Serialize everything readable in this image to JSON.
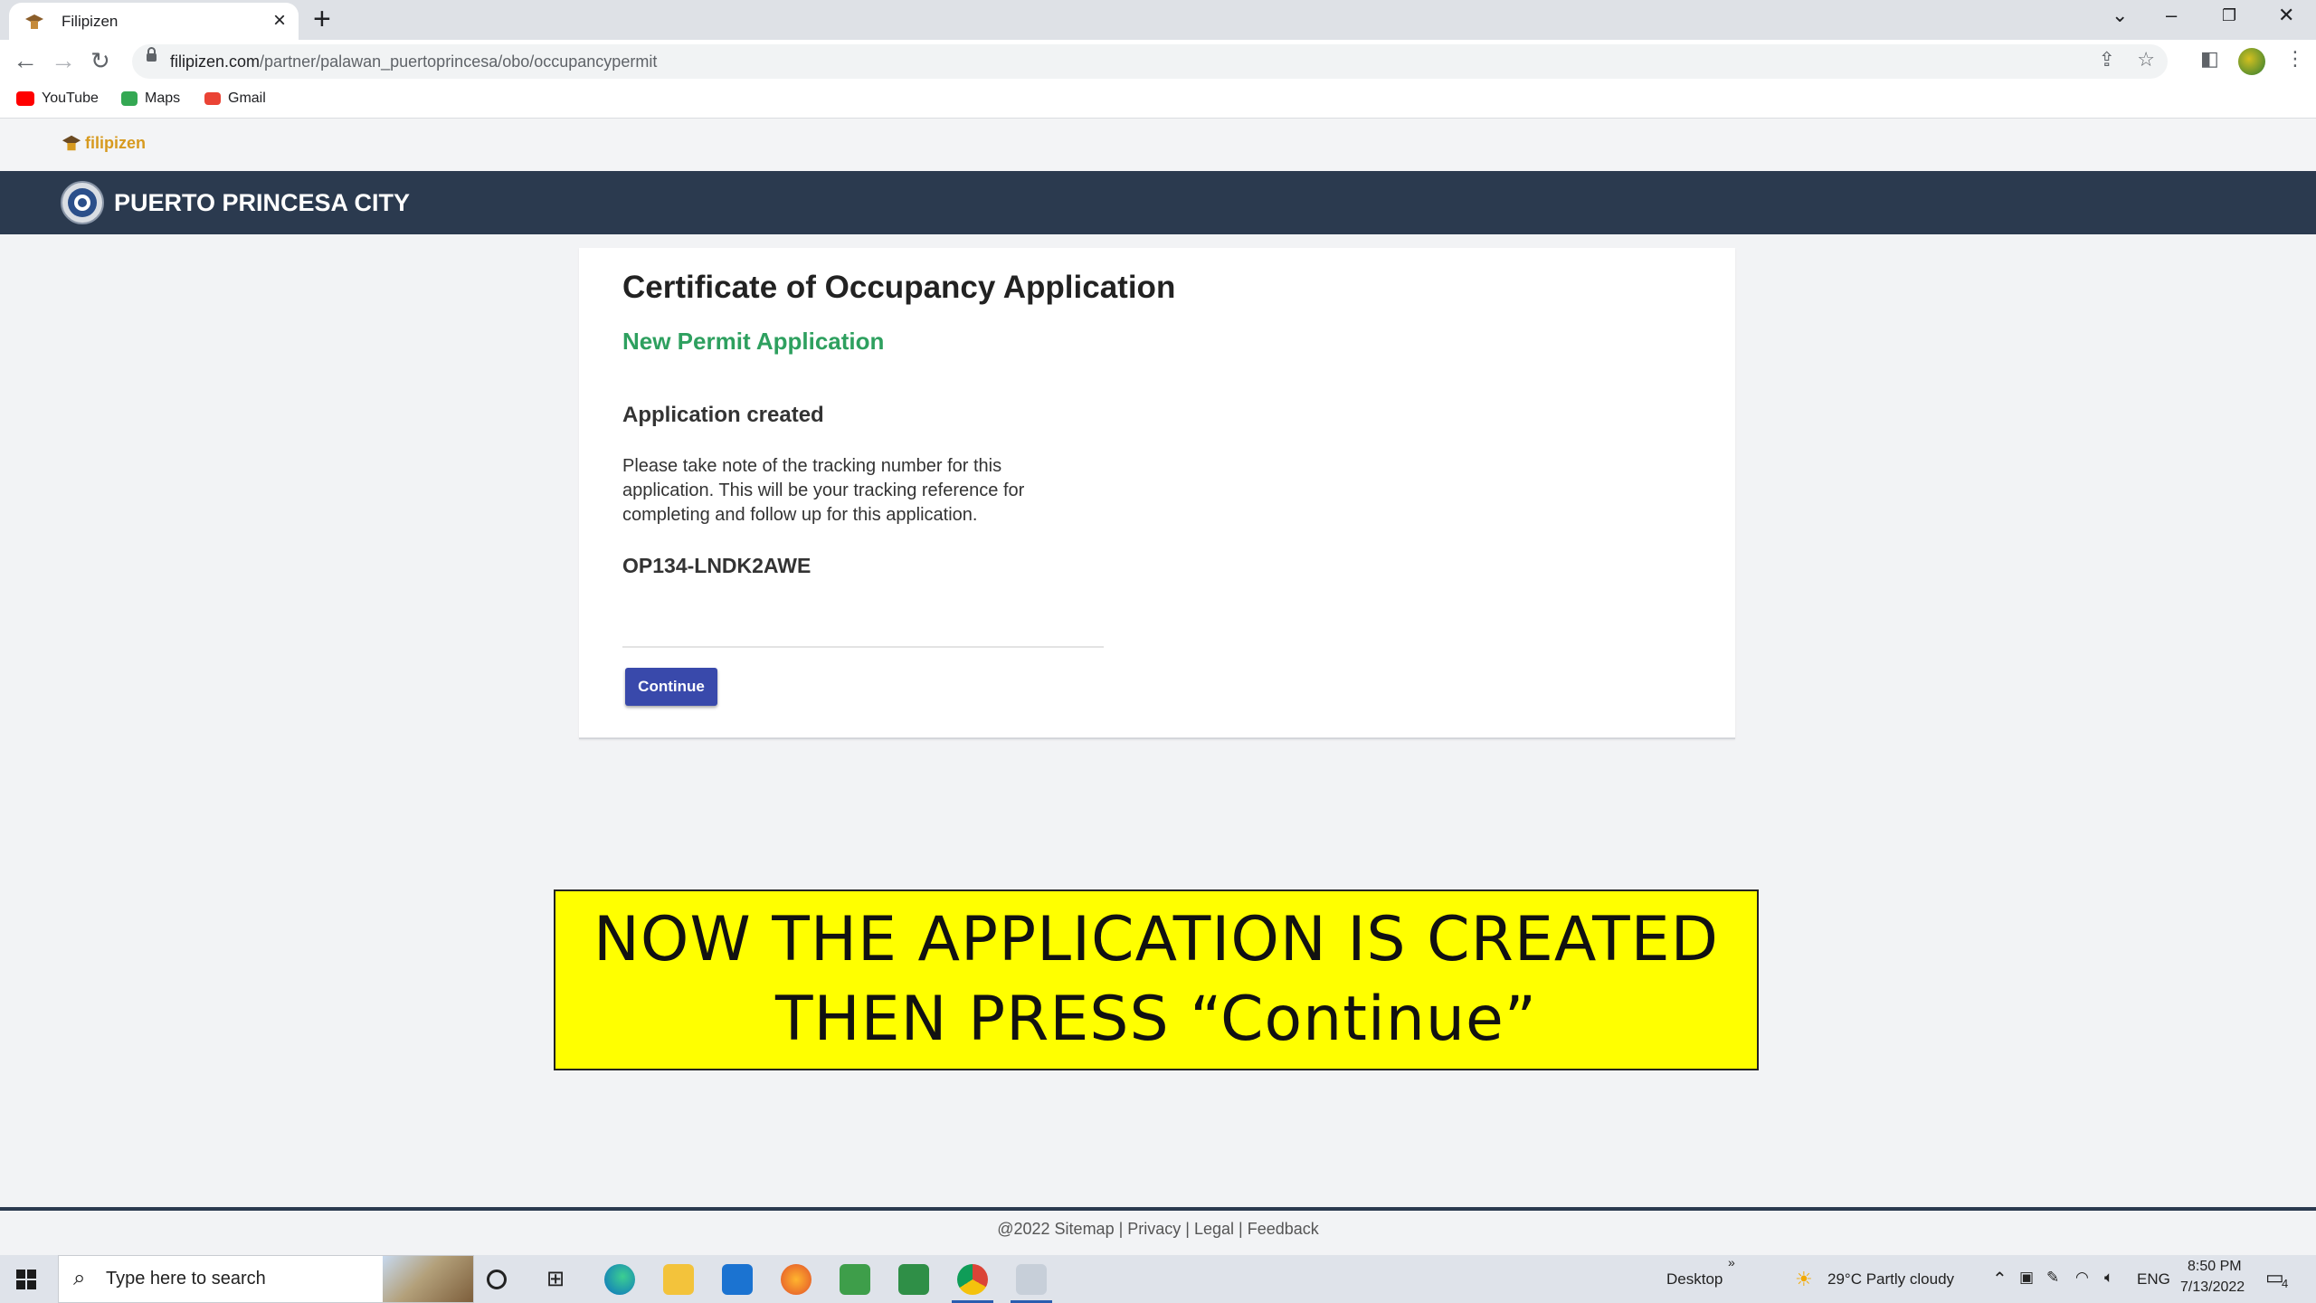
{
  "browser": {
    "tab_title": "Filipizen",
    "url_host": "filipizen.com",
    "url_path": "/partner/palawan_puertoprincesa/obo/occupancypermit",
    "bookmarks": [
      {
        "label": "YouTube",
        "icon": "youtube-icon",
        "color": "#ff0000"
      },
      {
        "label": "Maps",
        "icon": "maps-icon",
        "color": "#34a853"
      },
      {
        "label": "Gmail",
        "icon": "gmail-icon",
        "color": "#ea4335"
      }
    ]
  },
  "site": {
    "brand": "filipizen",
    "city": "PUERTO PRINCESA CITY",
    "colors": {
      "header_bg": "#2b3a4f",
      "brand": "#d79a1f",
      "accent_green": "#2ea05f",
      "button": "#3949ab"
    }
  },
  "card": {
    "title": "Certificate of Occupancy Application",
    "subtitle": "New Permit Application",
    "heading": "Application created",
    "message": "Please take note of the tracking number for this application. This will be your tracking reference for completing and follow up for this application.",
    "tracking_number": "OP134-LNDK2AWE",
    "continue_label": "Continue"
  },
  "callout": {
    "line1": "NOW THE APPLICATION IS CREATED",
    "line2": "THEN PRESS “Continue”"
  },
  "footer": {
    "copyright": "@2022",
    "links": [
      "Sitemap",
      "Privacy",
      "Legal",
      "Feedback"
    ]
  },
  "taskbar": {
    "search_placeholder": "Type here to search",
    "desktop_label": "Desktop",
    "weather": "29°C  Partly cloudy",
    "language": "ENG",
    "time": "8:50 PM",
    "date": "7/13/2022",
    "notification_count": "4"
  }
}
